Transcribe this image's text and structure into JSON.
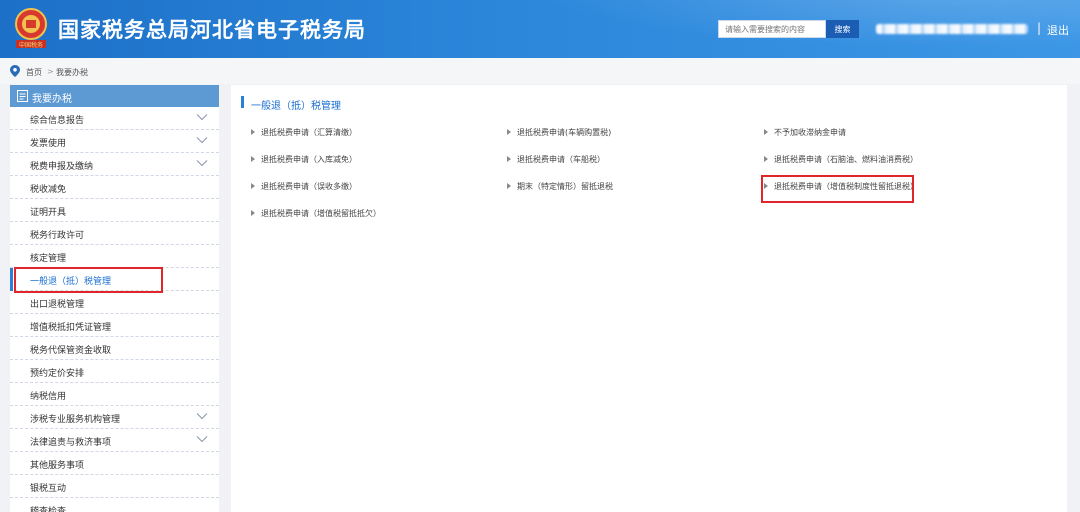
{
  "header": {
    "title": "国家税务总局河北省电子税务局",
    "emblem_text": "中国税务",
    "search_placeholder": "请输入需要搜索的内容",
    "search_button": "搜索",
    "separator": "|",
    "logout": "退出"
  },
  "breadcrumb": {
    "home": "首页",
    "separator": ">",
    "current": "我要办税"
  },
  "sidebar": {
    "header": "我要办税",
    "items": [
      {
        "label": "综合信息报告",
        "expandable": true
      },
      {
        "label": "发票使用",
        "expandable": true
      },
      {
        "label": "税费申报及缴纳",
        "expandable": true
      },
      {
        "label": "税收减免",
        "expandable": false
      },
      {
        "label": "证明开具",
        "expandable": false
      },
      {
        "label": "税务行政许可",
        "expandable": false
      },
      {
        "label": "核定管理",
        "expandable": false
      },
      {
        "label": "一般退（抵）税管理",
        "expandable": false,
        "active": true
      },
      {
        "label": "出口退税管理",
        "expandable": false
      },
      {
        "label": "增值税抵扣凭证管理",
        "expandable": false
      },
      {
        "label": "税务代保管资金收取",
        "expandable": false
      },
      {
        "label": "预约定价安排",
        "expandable": false
      },
      {
        "label": "纳税信用",
        "expandable": false
      },
      {
        "label": "涉税专业服务机构管理",
        "expandable": true
      },
      {
        "label": "法律追责与救济事项",
        "expandable": true
      },
      {
        "label": "其他服务事项",
        "expandable": false
      },
      {
        "label": "银税互动",
        "expandable": false
      },
      {
        "label": "稽查检查",
        "expandable": false
      }
    ]
  },
  "main": {
    "title": "一般退（抵）税管理",
    "links": [
      [
        "退抵税费申请（汇算清缴）",
        "退抵税费申请(车辆购置税)",
        "不予加收滞纳金申请"
      ],
      [
        "退抵税费申请（入库减免）",
        "退抵税费申请（车船税）",
        "退抵税费申请（石脑油、燃料油消费税）"
      ],
      [
        "退抵税费申请（误收多缴）",
        "期末（特定情形）留抵退税",
        "退抵税费申请（增值税制度性留抵退税）"
      ],
      [
        "退抵税费申请（增值税留抵抵欠）",
        "",
        ""
      ]
    ]
  },
  "colors": {
    "header_start": "#1d70c7",
    "accent": "#2b7fd6",
    "sidebar_header": "#5d99d3",
    "highlight": "#e0262b"
  }
}
